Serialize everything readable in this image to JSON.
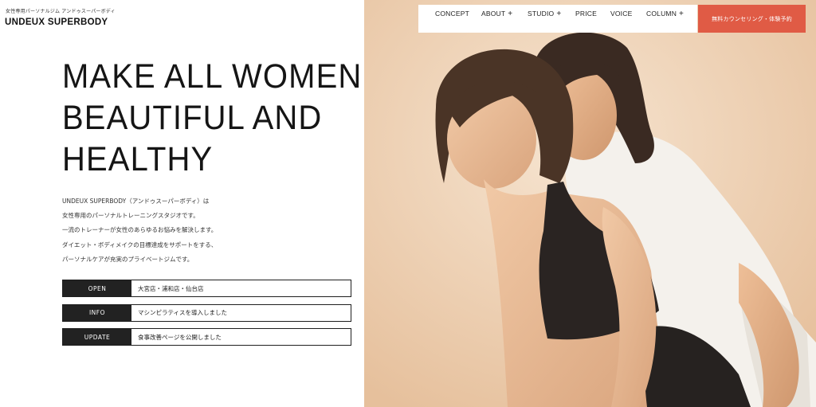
{
  "header": {
    "tagline": "女性専用パーソナルジム アンドゥスーパーボディ",
    "logo": "UNDEUX SUPERBODY"
  },
  "nav": {
    "items": [
      {
        "label": "CONCEPT",
        "has_submenu": false
      },
      {
        "label": "ABOUT",
        "has_submenu": true
      },
      {
        "label": "STUDIO",
        "has_submenu": true
      },
      {
        "label": "PRICE",
        "has_submenu": false
      },
      {
        "label": "VOICE",
        "has_submenu": false
      },
      {
        "label": "COLUMN",
        "has_submenu": true
      }
    ],
    "submenu_glyph": "+",
    "cta_label": "無料カウンセリング・体験予約"
  },
  "hero": {
    "lines": [
      "MAKE ALL WOMEN",
      "BEAUTIFUL AND",
      "HEALTHY"
    ]
  },
  "description": [
    "UNDEUX SUPERBODY（アンドゥスーパーボディ）は",
    "女性専用のパーソナルトレーニングスタジオです。",
    "一流のトレーナーが女性のあらゆるお悩みを解決します。",
    "ダイエット・ボディメイクの目標達成をサポートをする、",
    "パーソナルケアが充実のプライベートジムです。"
  ],
  "news": [
    {
      "tag": "OPEN",
      "text": "大宮店・浦和店・仙台店"
    },
    {
      "tag": "INFO",
      "text": "マシンピラティスを導入しました"
    },
    {
      "tag": "UPDATE",
      "text": "食事改善ページを公開しました"
    }
  ],
  "colors": {
    "accent": "#e05b45",
    "tag_bg": "#222222",
    "photo_bg": "#ecd2b6"
  }
}
